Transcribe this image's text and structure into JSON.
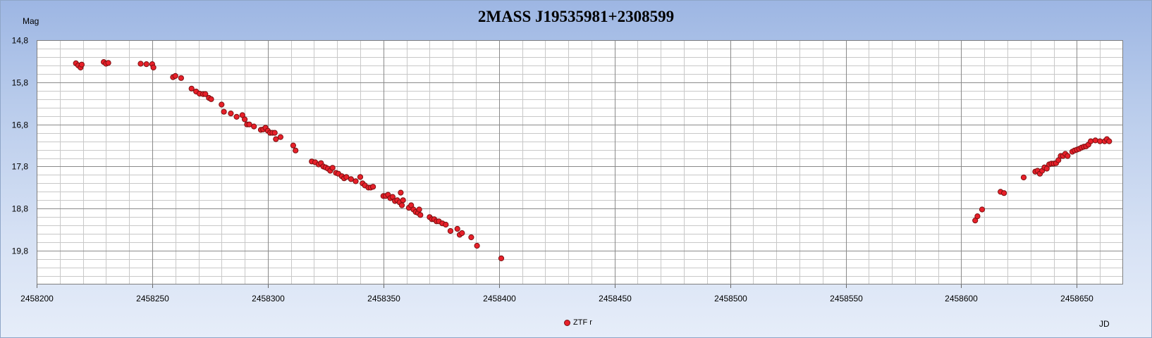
{
  "chart_data": {
    "type": "scatter",
    "title": "2MASS J19535981+2308599",
    "xlabel": "JD",
    "ylabel": "Mag",
    "xlim": [
      2458200,
      2458670
    ],
    "ylim": [
      20.6,
      14.8
    ],
    "y_inverted": true,
    "grid": true,
    "legend_position": "bottom-center",
    "x_ticks": [
      2458200,
      2458250,
      2458300,
      2458350,
      2458400,
      2458450,
      2458500,
      2458550,
      2458600,
      2458650
    ],
    "x_tick_labels": [
      "2458200",
      "2458250",
      "2458300",
      "2458350",
      "2458400",
      "2458450",
      "2458500",
      "2458550",
      "2458600",
      "2458650"
    ],
    "y_ticks": [
      14.8,
      15.8,
      16.8,
      17.8,
      18.8,
      19.8
    ],
    "y_tick_labels": [
      "14,8",
      "15,8",
      "16,8",
      "17,8",
      "18,8",
      "19,8"
    ],
    "colors": {
      "marker_fill": "#e8202a",
      "marker_stroke": "#7a1010"
    },
    "series": [
      {
        "name": "ZTF r",
        "points": [
          [
            2458217,
            15.35
          ],
          [
            2458218,
            15.4
          ],
          [
            2458219,
            15.45
          ],
          [
            2458219.5,
            15.38
          ],
          [
            2458229,
            15.32
          ],
          [
            2458230,
            15.36
          ],
          [
            2458231,
            15.34
          ],
          [
            2458245,
            15.36
          ],
          [
            2458247.5,
            15.37
          ],
          [
            2458250,
            15.37
          ],
          [
            2458250.5,
            15.45
          ],
          [
            2458259,
            15.68
          ],
          [
            2458260,
            15.65
          ],
          [
            2458262.5,
            15.7
          ],
          [
            2458267,
            15.95
          ],
          [
            2458269,
            16.02
          ],
          [
            2458270.5,
            16.07
          ],
          [
            2458272,
            16.08
          ],
          [
            2458273,
            16.08
          ],
          [
            2458274.5,
            16.17
          ],
          [
            2458275.5,
            16.2
          ],
          [
            2458280,
            16.33
          ],
          [
            2458281,
            16.5
          ],
          [
            2458284,
            16.54
          ],
          [
            2458286.5,
            16.62
          ],
          [
            2458289,
            16.58
          ],
          [
            2458290,
            16.68
          ],
          [
            2458291,
            16.8
          ],
          [
            2458292,
            16.8
          ],
          [
            2458294,
            16.85
          ],
          [
            2458297,
            16.93
          ],
          [
            2458298,
            16.92
          ],
          [
            2458299,
            16.88
          ],
          [
            2458300,
            16.95
          ],
          [
            2458301,
            17.0
          ],
          [
            2458302,
            17.0
          ],
          [
            2458303,
            17.0
          ],
          [
            2458303.5,
            17.15
          ],
          [
            2458305.5,
            17.1
          ],
          [
            2458311,
            17.3
          ],
          [
            2458312,
            17.42
          ],
          [
            2458319,
            17.68
          ],
          [
            2458320.5,
            17.7
          ],
          [
            2458322,
            17.75
          ],
          [
            2458323,
            17.72
          ],
          [
            2458324,
            17.8
          ],
          [
            2458325,
            17.82
          ],
          [
            2458326,
            17.85
          ],
          [
            2458327,
            17.9
          ],
          [
            2458328,
            17.83
          ],
          [
            2458329.5,
            17.95
          ],
          [
            2458330.5,
            17.97
          ],
          [
            2458332,
            18.03
          ],
          [
            2458333,
            18.08
          ],
          [
            2458334,
            18.05
          ],
          [
            2458336,
            18.1
          ],
          [
            2458338,
            18.15
          ],
          [
            2458340,
            18.05
          ],
          [
            2458341,
            18.2
          ],
          [
            2458342,
            18.25
          ],
          [
            2458343.5,
            18.3
          ],
          [
            2458344.5,
            18.3
          ],
          [
            2458345.5,
            18.28
          ],
          [
            2458350,
            18.5
          ],
          [
            2458351,
            18.5
          ],
          [
            2458352,
            18.47
          ],
          [
            2458353,
            18.55
          ],
          [
            2458354,
            18.52
          ],
          [
            2458355,
            18.62
          ],
          [
            2458356,
            18.6
          ],
          [
            2458357,
            18.65
          ],
          [
            2458357.5,
            18.42
          ],
          [
            2458358,
            18.72
          ],
          [
            2458358.5,
            18.6
          ],
          [
            2458361,
            18.78
          ],
          [
            2458362,
            18.72
          ],
          [
            2458363,
            18.82
          ],
          [
            2458364,
            18.88
          ],
          [
            2458365,
            18.9
          ],
          [
            2458365.5,
            18.82
          ],
          [
            2458366,
            18.95
          ],
          [
            2458370,
            19.0
          ],
          [
            2458371,
            19.05
          ],
          [
            2458372,
            19.05
          ],
          [
            2458373,
            19.1
          ],
          [
            2458374,
            19.1
          ],
          [
            2458375.5,
            19.15
          ],
          [
            2458377,
            19.18
          ],
          [
            2458379,
            19.33
          ],
          [
            2458382,
            19.28
          ],
          [
            2458383,
            19.42
          ],
          [
            2458384,
            19.38
          ],
          [
            2458388,
            19.48
          ],
          [
            2458390.5,
            19.68
          ],
          [
            2458401,
            19.98
          ],
          [
            2458606,
            19.08
          ],
          [
            2458607,
            18.98
          ],
          [
            2458609,
            18.82
          ],
          [
            2458617,
            18.4
          ],
          [
            2458618.5,
            18.43
          ],
          [
            2458627,
            18.06
          ],
          [
            2458632,
            17.92
          ],
          [
            2458633,
            17.9
          ],
          [
            2458634,
            17.97
          ],
          [
            2458635,
            17.9
          ],
          [
            2458636,
            17.82
          ],
          [
            2458637,
            17.85
          ],
          [
            2458638,
            17.75
          ],
          [
            2458639,
            17.73
          ],
          [
            2458640,
            17.73
          ],
          [
            2458641,
            17.72
          ],
          [
            2458642,
            17.65
          ],
          [
            2458643,
            17.55
          ],
          [
            2458644,
            17.55
          ],
          [
            2458645,
            17.5
          ],
          [
            2458646,
            17.55
          ],
          [
            2458648,
            17.45
          ],
          [
            2458649,
            17.42
          ],
          [
            2458650,
            17.4
          ],
          [
            2458651,
            17.38
          ],
          [
            2458652,
            17.35
          ],
          [
            2458653,
            17.33
          ],
          [
            2458654,
            17.32
          ],
          [
            2458655,
            17.28
          ],
          [
            2458656,
            17.2
          ],
          [
            2458658,
            17.18
          ],
          [
            2458660,
            17.2
          ],
          [
            2458662,
            17.2
          ],
          [
            2458663,
            17.15
          ],
          [
            2458664,
            17.2
          ]
        ]
      }
    ]
  }
}
